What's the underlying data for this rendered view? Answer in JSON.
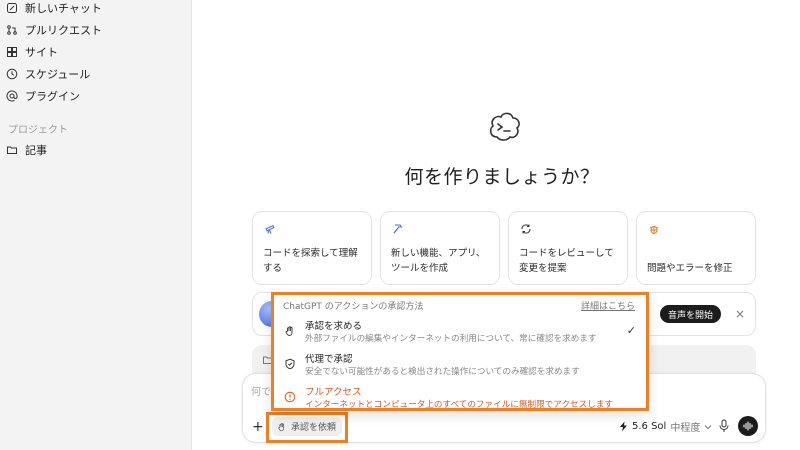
{
  "sidebar": {
    "items": [
      {
        "label": "新しいチャット"
      },
      {
        "label": "プルリクエスト"
      },
      {
        "label": "サイト"
      },
      {
        "label": "スケジュール"
      },
      {
        "label": "プラグイン"
      }
    ],
    "section_label": "プロジェクト",
    "projects": [
      {
        "label": "記事"
      }
    ]
  },
  "main": {
    "title": "何を作りましょうか？",
    "cards": [
      {
        "line1": "コードを探索して理解",
        "line2": "する"
      },
      {
        "line1": "新しい機能、アプリ、",
        "line2": "ツールを作成"
      },
      {
        "line1": "コードをレビューして",
        "line2": "変更を提案"
      },
      {
        "line1": "",
        "line2": "問題やエラーを修正"
      }
    ],
    "voice_button": "音声を開始",
    "close_symbol": "×"
  },
  "popover": {
    "header": "ChatGPT のアクションの承認方法",
    "link": "詳細はこちら",
    "options": [
      {
        "title": "承認を求める",
        "desc": "外部ファイルの編集やインターネットの利用について、常に確認を求めます",
        "selected_mark": "✓"
      },
      {
        "title": "代理で承認",
        "desc": "安全でない可能性があると検出された操作についてのみ確認を求めます"
      },
      {
        "title": "フルアクセス",
        "desc": "インターネットとコンピュータ上のすべてのファイルに無制限でアクセスします"
      }
    ],
    "colors": {
      "highlight": "#f07f24",
      "danger": "#e2561d"
    }
  },
  "composer": {
    "placeholder": "何で",
    "plus": "+",
    "approval_label": "承認を依頼",
    "model": "5.6 Sol",
    "effort": "中程度"
  }
}
